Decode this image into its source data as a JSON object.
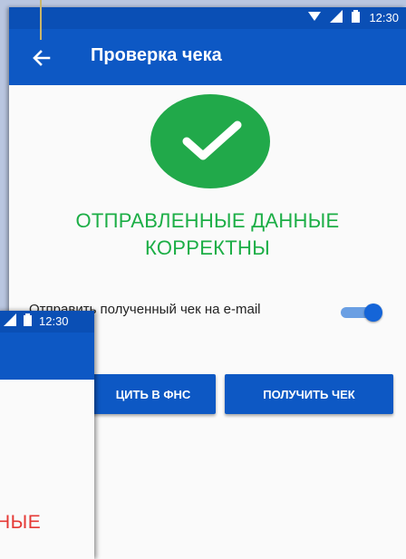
{
  "back_screen": {
    "status_time": "12:30",
    "title": "Проверка чека",
    "success_line1": "ОТПРАВЛЕННЫЕ ДАННЫЕ",
    "success_line2": "КОРРЕКТНЫ",
    "email_label": "Отправить полученный чек на e-mail",
    "email_toggle_on": true,
    "button_fns": "ЦИТЬ В ФНС",
    "button_get": "ПОЛУЧИТЬ ЧЕК"
  },
  "front_screen": {
    "status_time": "12:30",
    "error_text": "НЫЕ"
  },
  "colors": {
    "primary": "#0d58c4",
    "success": "#1cae46",
    "error": "#e53935"
  }
}
